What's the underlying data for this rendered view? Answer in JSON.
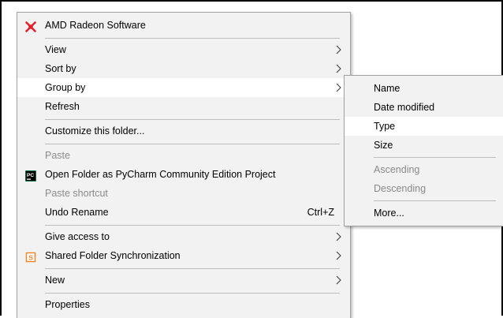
{
  "context_menu": {
    "items": [
      {
        "label": "AMD Radeon Software",
        "icon": "amd-radeon-icon"
      },
      {
        "label": "View",
        "submenu": true
      },
      {
        "label": "Sort by",
        "submenu": true
      },
      {
        "label": "Group by",
        "submenu": true,
        "highlighted": true
      },
      {
        "label": "Refresh"
      },
      {
        "label": "Customize this folder..."
      },
      {
        "label": "Paste",
        "disabled": true
      },
      {
        "label": "Open Folder as PyCharm Community Edition Project",
        "icon": "pycharm-icon"
      },
      {
        "label": "Paste shortcut",
        "disabled": true
      },
      {
        "label": "Undo Rename",
        "shortcut": "Ctrl+Z"
      },
      {
        "label": "Give access to",
        "submenu": true
      },
      {
        "label": "Shared Folder Synchronization",
        "icon": "sync-icon",
        "submenu": true
      },
      {
        "label": "New",
        "submenu": true
      },
      {
        "label": "Properties"
      }
    ]
  },
  "group_by_submenu": {
    "items": [
      {
        "label": "Name"
      },
      {
        "label": "Date modified"
      },
      {
        "label": "Type",
        "highlighted": true
      },
      {
        "label": "Size"
      },
      {
        "label": "Ascending",
        "disabled": true
      },
      {
        "label": "Descending",
        "disabled": true
      },
      {
        "label": "More..."
      }
    ]
  },
  "colors": {
    "menu_bg": "#f2f2f2",
    "highlight": "#ffffff",
    "disabled_text": "#8a8a8a",
    "amd_red": "#e4202e",
    "pycharm_black": "#000000",
    "pycharm_green": "#21d789",
    "sync_orange": "#f0821e"
  }
}
